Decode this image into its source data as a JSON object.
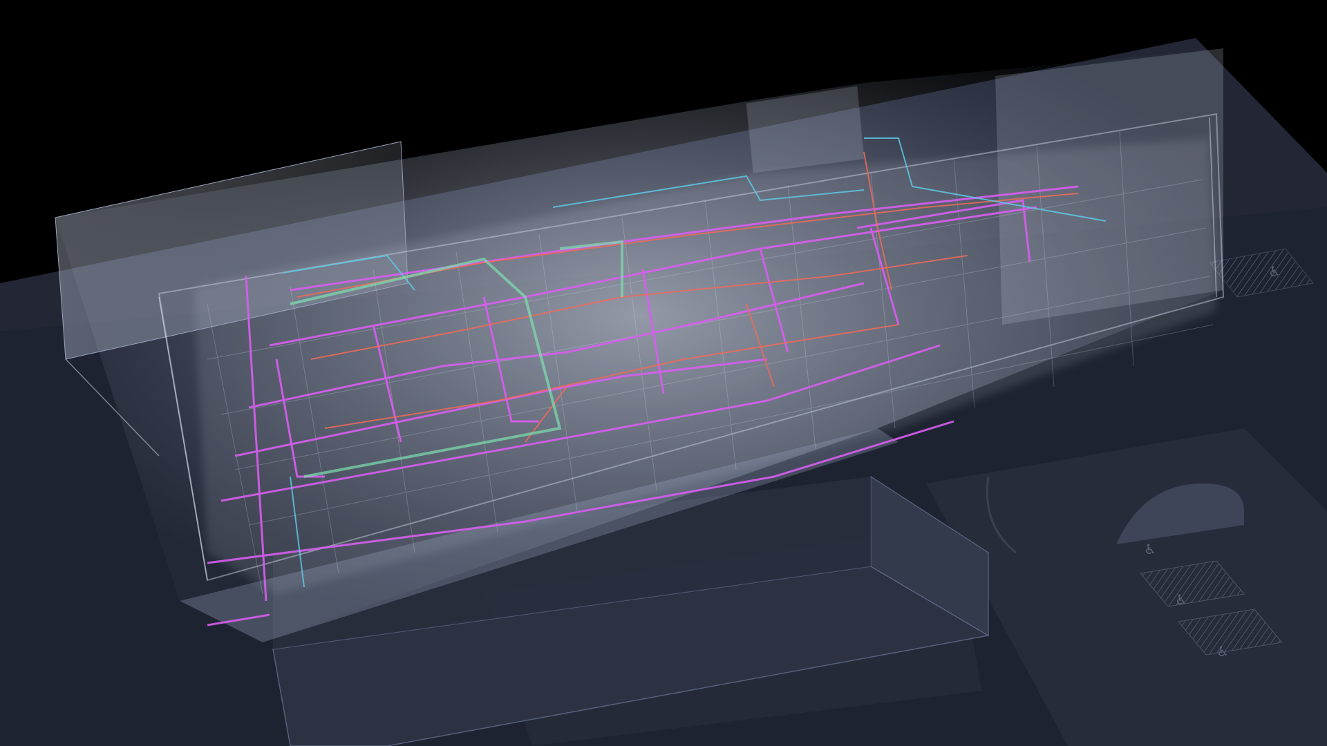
{
  "scene": {
    "subject": "translucent-3d-building-model-with-mep-routing",
    "background_color": "#000000",
    "ground_color": "#1f2433",
    "building_color": "#c8d2e6",
    "system_colors": {
      "electrical": "#d85ef0",
      "heating": "#f06a5a",
      "water": "#5ec8e6",
      "supply_air": "#7ee0b0"
    },
    "symbols": [
      "accessible-parking-icon"
    ]
  }
}
